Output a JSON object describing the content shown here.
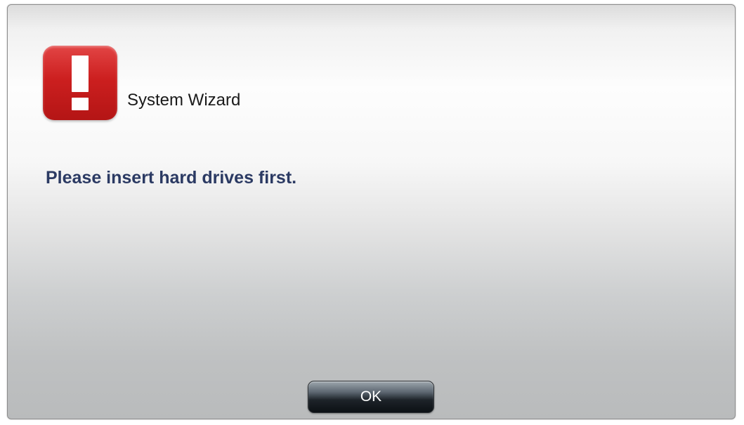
{
  "dialog": {
    "title": "System Wizard",
    "icon": "exclamation-alert-icon",
    "message": "Please insert hard drives first.",
    "ok_label": "OK"
  },
  "colors": {
    "icon_red": "#cc1f1f",
    "message_text": "#2b3a63",
    "button_dark": "#1d2329"
  }
}
